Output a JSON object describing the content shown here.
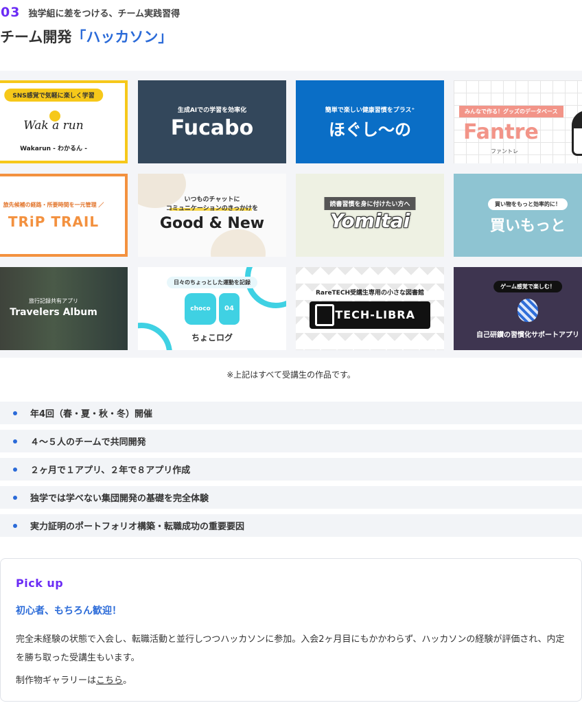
{
  "section": {
    "number": "03",
    "subtitle": "独学組に差をつける、チーム実践習得",
    "title_prefix": "チーム開発",
    "title_accent": "「ハッカソン」"
  },
  "gallery": [
    {
      "name": "wakarun",
      "tagline": "SNS感覚で気軽に楽しく学習",
      "logo": "Wak a run",
      "caption": "Wakarun - わかるん -"
    },
    {
      "name": "fucabo",
      "tagline": "生成AIでの学習を効率化",
      "title": "Fucabo"
    },
    {
      "name": "hogushi",
      "tagline": "簡単で楽しい健康習慣をプラス⁺",
      "title": "ほぐし〜の"
    },
    {
      "name": "fantre",
      "tagline": "みんなで作る！グッズのデータベース",
      "title": "Fantre",
      "caption": "ファントレ"
    },
    {
      "name": "trip-trail",
      "tagline": "旅先候補の経路・所要時間を一元管理 ／",
      "title": "TRiP TRAIL"
    },
    {
      "name": "good-new",
      "tagline_1": "いつものチャットに",
      "tagline_2": "コミュニケーションのきっかけを",
      "title": "Good & New"
    },
    {
      "name": "yomitai",
      "tagline": "読書習慣を身に付けたい方へ",
      "title": "Yomitai"
    },
    {
      "name": "kaimotto",
      "tagline": "買い物をもっと効率的に！",
      "title": "買いもっと"
    },
    {
      "name": "travelers-album",
      "tagline": "旅行記録共有アプリ",
      "title": "Travelers Album"
    },
    {
      "name": "chocolog",
      "tagline": "日々のちょっとした運動を記録",
      "logo": "choco log",
      "number": "04",
      "title": "ちょこログ"
    },
    {
      "name": "tech-libra",
      "tagline": "RareTECH受講生専用の小さな図書館",
      "title": "TECH-LIBRA"
    },
    {
      "name": "game-app",
      "tagline": "ゲーム感覚で楽しむ！",
      "title": "自己研鑽の習慣化サポートアプリ"
    }
  ],
  "note": "※上記はすべて受講生の作品です。",
  "features": [
    "年4回（春・夏・秋・冬）開催",
    "４～５人のチームで共同開発",
    "２ヶ月で１アプリ、２年で８アプリ作成",
    "独学では学べない集団開発の基礎を完全体験",
    "実力証明のポートフォリオ構築・転職成功の重要要因"
  ],
  "pickup": {
    "label": "Pick up",
    "heading": "初心者、もちろん歓迎！",
    "body": "完全未経験の状態で入会し、転職活動と並行しつつハッカソンに参加。入会2ヶ月目にもかかわらず、ハッカソンの経験が評価され、内定を勝ち取った受講生もいます。",
    "gallery_prefix": "制作物ギャラリーは",
    "gallery_link": "こちら",
    "gallery_suffix": "。"
  },
  "colors": {
    "accent_purple": "#6b2cf5",
    "accent_blue": "#2a6ad8"
  }
}
